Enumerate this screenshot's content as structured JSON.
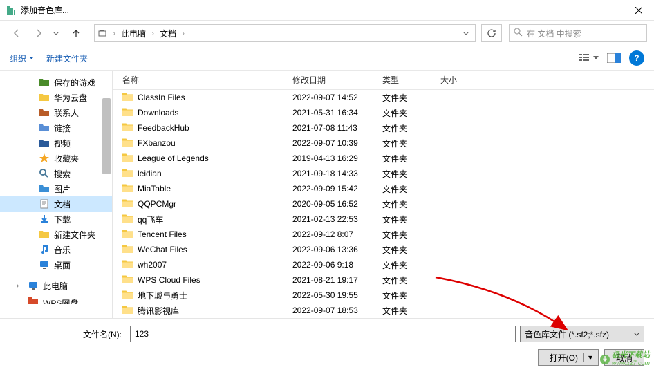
{
  "title": "添加音色库...",
  "breadcrumb": {
    "root": "此电脑",
    "current": "文档"
  },
  "search": {
    "placeholder": "在 文档 中搜索"
  },
  "toolbar": {
    "organize": "组织",
    "newFolder": "新建文件夹"
  },
  "columns": {
    "name": "名称",
    "date": "修改日期",
    "type": "类型",
    "size": "大小"
  },
  "sidebar": [
    {
      "label": "保存的游戏",
      "icon": "game"
    },
    {
      "label": "华为云盘",
      "icon": "folder"
    },
    {
      "label": "联系人",
      "icon": "contacts"
    },
    {
      "label": "链接",
      "icon": "link"
    },
    {
      "label": "视频",
      "icon": "video"
    },
    {
      "label": "收藏夹",
      "icon": "star"
    },
    {
      "label": "搜索",
      "icon": "search"
    },
    {
      "label": "图片",
      "icon": "picture"
    },
    {
      "label": "文档",
      "icon": "doc",
      "selected": true
    },
    {
      "label": "下载",
      "icon": "download"
    },
    {
      "label": "新建文件夹",
      "icon": "folder"
    },
    {
      "label": "音乐",
      "icon": "music"
    },
    {
      "label": "桌面",
      "icon": "desktop"
    }
  ],
  "sidebar2": [
    {
      "label": "此电脑",
      "icon": "pc",
      "expandable": true
    },
    {
      "label": "WPS网盘",
      "icon": "wps",
      "cut": true
    }
  ],
  "files": [
    {
      "name": "ClassIn Files",
      "date": "2022-09-07 14:52",
      "type": "文件夹"
    },
    {
      "name": "Downloads",
      "date": "2021-05-31 16:34",
      "type": "文件夹"
    },
    {
      "name": "FeedbackHub",
      "date": "2021-07-08 11:43",
      "type": "文件夹"
    },
    {
      "name": "FXbanzou",
      "date": "2022-09-07 10:39",
      "type": "文件夹"
    },
    {
      "name": "League of Legends",
      "date": "2019-04-13 16:29",
      "type": "文件夹"
    },
    {
      "name": "leidian",
      "date": "2021-09-18 14:33",
      "type": "文件夹"
    },
    {
      "name": "MiaTable",
      "date": "2022-09-09 15:42",
      "type": "文件夹"
    },
    {
      "name": "QQPCMgr",
      "date": "2020-09-05 16:52",
      "type": "文件夹"
    },
    {
      "name": "qq飞车",
      "date": "2021-02-13 22:53",
      "type": "文件夹"
    },
    {
      "name": "Tencent Files",
      "date": "2022-09-12 8:07",
      "type": "文件夹"
    },
    {
      "name": "WeChat Files",
      "date": "2022-09-06 13:36",
      "type": "文件夹"
    },
    {
      "name": "wh2007",
      "date": "2022-09-06 9:18",
      "type": "文件夹"
    },
    {
      "name": "WPS Cloud Files",
      "date": "2021-08-21 19:17",
      "type": "文件夹"
    },
    {
      "name": "地下城与勇士",
      "date": "2022-05-30 19:55",
      "type": "文件夹"
    },
    {
      "name": "腾讯影视库",
      "date": "2022-09-07 18:53",
      "type": "文件夹"
    }
  ],
  "filename": {
    "label": "文件名(N):",
    "value": "123"
  },
  "filter": "音色库文件 (*.sf2;*.sfz)",
  "buttons": {
    "open": "打开(O)",
    "cancel": "取消"
  },
  "watermark": "极光下载站\nwww.xz7.com"
}
